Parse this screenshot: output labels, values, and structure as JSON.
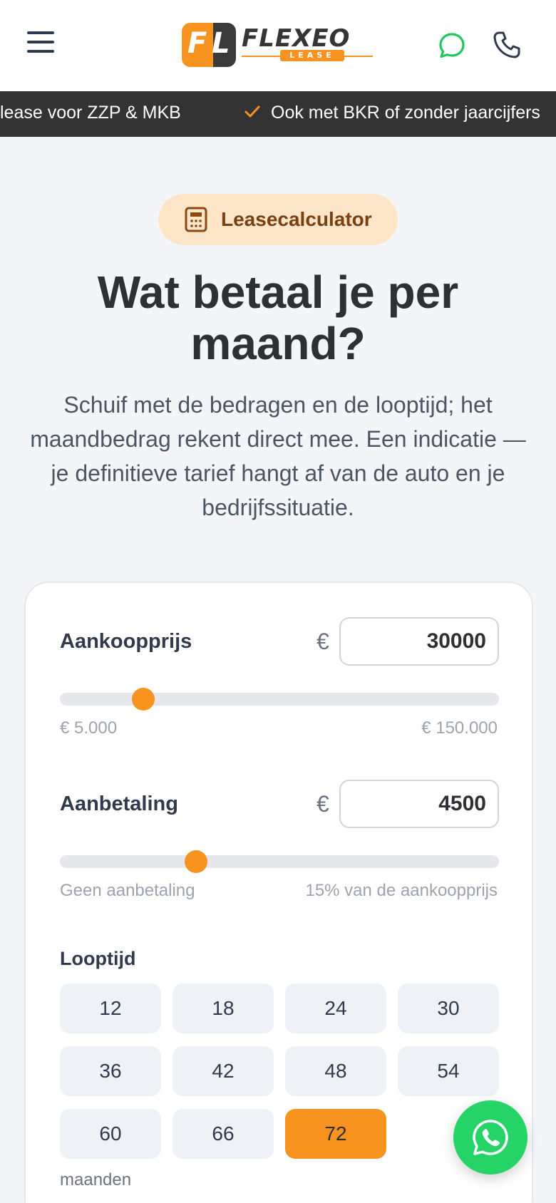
{
  "header": {
    "logo_mark_left": "F",
    "logo_mark_right": "L",
    "logo_name": "FLEXEO",
    "logo_sub": "LEASE",
    "icons": [
      "menu-icon",
      "chat-icon",
      "phone-icon"
    ],
    "accent_color": "#f7931e",
    "chat_color": "#22c55e"
  },
  "ticker": {
    "item1": "lease voor ZZP & MKB",
    "item2": "Ook met BKR of zonder jaarcijfers"
  },
  "hero": {
    "badge": "Leasecalculator",
    "title": "Wat betaal je per maand?",
    "description": "Schuif met de bedragen en de looptijd; het maandbedrag rekent direct mee. Een indicatie — je definitieve tarief hangt af van de auto en je bedrijfssituatie."
  },
  "calculator": {
    "purchase": {
      "label": "Aankoopprijs",
      "currency": "€",
      "value": "30000",
      "min_label": "€ 5.000",
      "max_label": "€ 150.000",
      "slider_fraction": 0.19
    },
    "down_payment": {
      "label": "Aanbetaling",
      "currency": "€",
      "value": "4500",
      "min_label": "Geen aanbetaling",
      "max_label": "15% van de aankoopprijs",
      "slider_fraction": 0.31
    },
    "term": {
      "label": "Looptijd",
      "options": [
        "12",
        "18",
        "24",
        "30",
        "36",
        "42",
        "48",
        "54",
        "60",
        "66",
        "72"
      ],
      "selected": "72",
      "unit": "maanden"
    }
  },
  "whatsapp": {
    "icon": "whatsapp-icon",
    "color": "#25d366"
  }
}
